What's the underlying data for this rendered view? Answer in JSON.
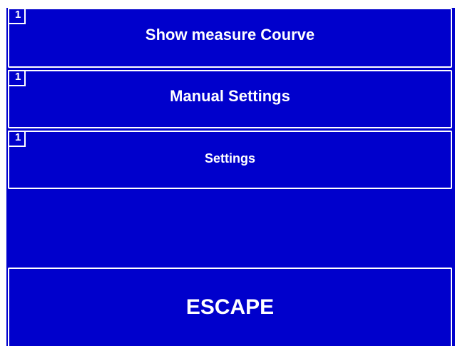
{
  "menu": {
    "items": [
      {
        "label": "Show measure Courve",
        "level": "1"
      },
      {
        "label": "Manual Settings",
        "level": "1"
      },
      {
        "label": "Settings",
        "level": "1"
      }
    ],
    "escape_label": "ESCAPE"
  },
  "colors": {
    "background": "#0000cc",
    "border": "#ffffff",
    "text": "#ffffff"
  }
}
